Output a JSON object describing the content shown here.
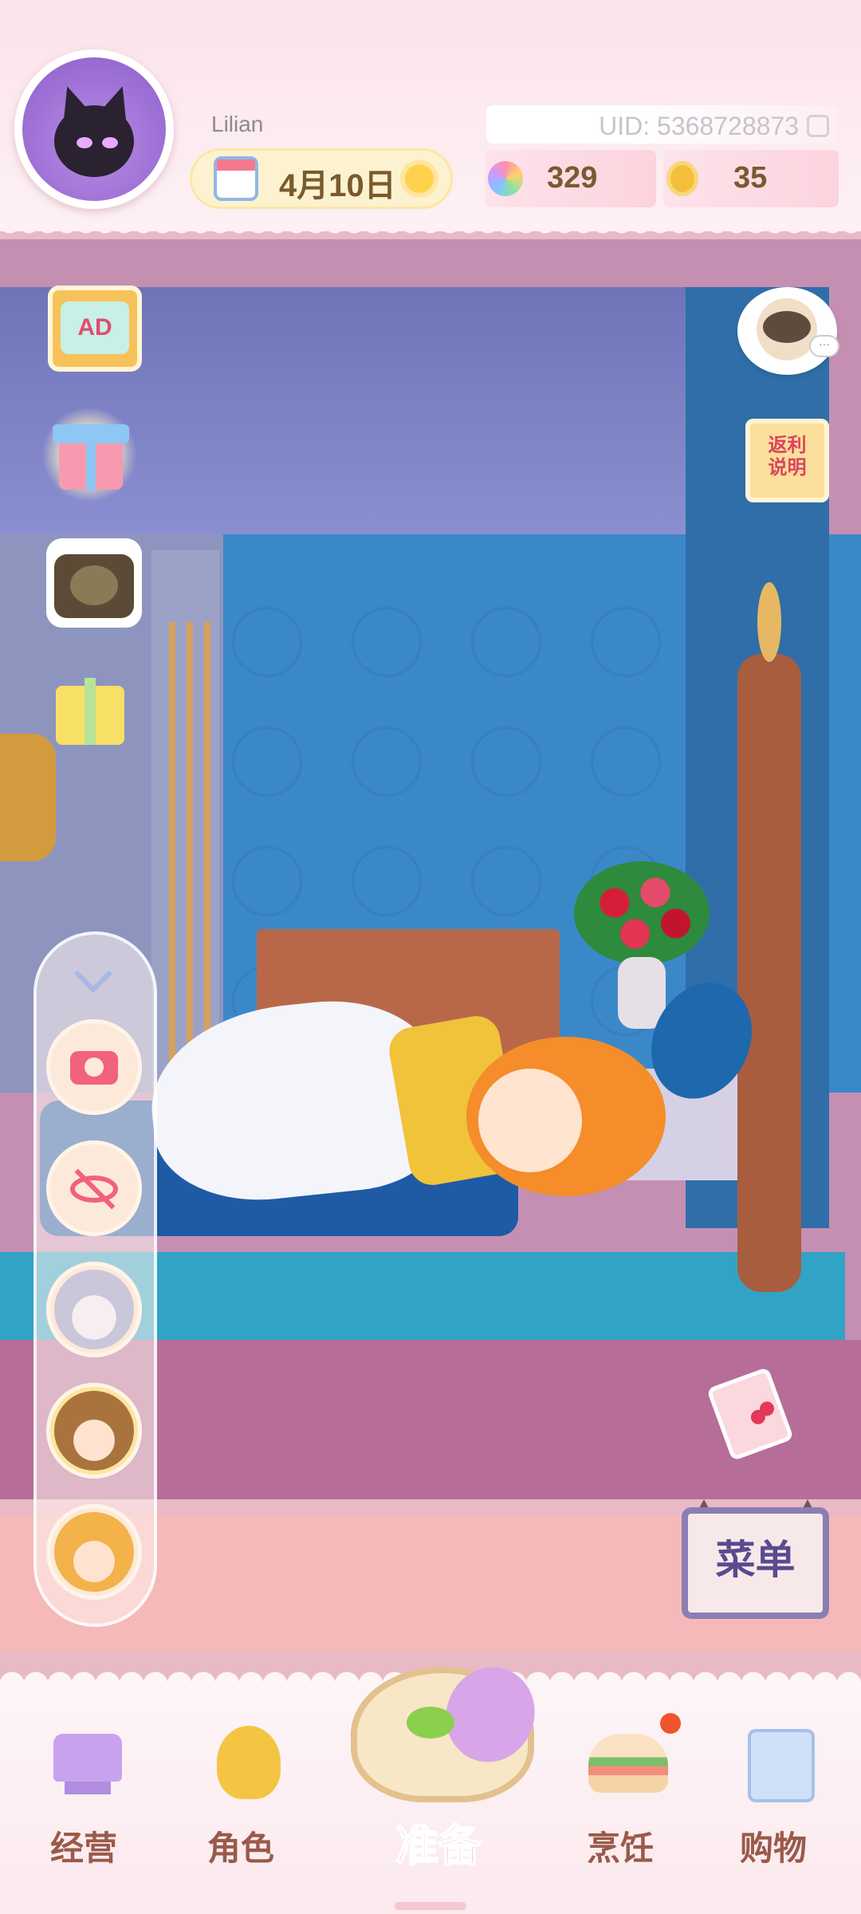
{
  "header": {
    "username": "Lilian",
    "uid": "UID: 5368728873",
    "date": "4月10日",
    "weather_icon": "sun-icon",
    "gems": "329",
    "coins": "35"
  },
  "side_buttons_left": [
    {
      "name": "ad-reward",
      "label": "AD"
    },
    {
      "name": "gift-box",
      "icon": "gift-icon"
    },
    {
      "name": "treasure-chest",
      "icon": "chest-icon"
    },
    {
      "name": "present",
      "icon": "gift-icon"
    }
  ],
  "side_buttons_right": {
    "rebate_label": "返利说明",
    "menu_label": "菜单",
    "chat_bubble": "···"
  },
  "side_panel": {
    "items": [
      "chevron-down-icon",
      "camera-icon",
      "hide-ui-icon",
      "character-portrait-1",
      "character-portrait-2",
      "character-portrait-3"
    ]
  },
  "bottom_nav": {
    "items": [
      {
        "label": "经营",
        "icon": "top-hat-icon"
      },
      {
        "label": "角色",
        "icon": "character-doll-icon"
      },
      {
        "label": "准备",
        "icon": "picnic-basket-icon"
      },
      {
        "label": "烹饪",
        "icon": "sandwich-icon"
      },
      {
        "label": "购物",
        "icon": "shopping-bag-icon"
      }
    ]
  },
  "colors": {
    "header_bg": "#fbe3ea",
    "accent_pink": "#f2617f",
    "nav_label": "#9a5a49",
    "wall_blue": "#3b88c9"
  }
}
